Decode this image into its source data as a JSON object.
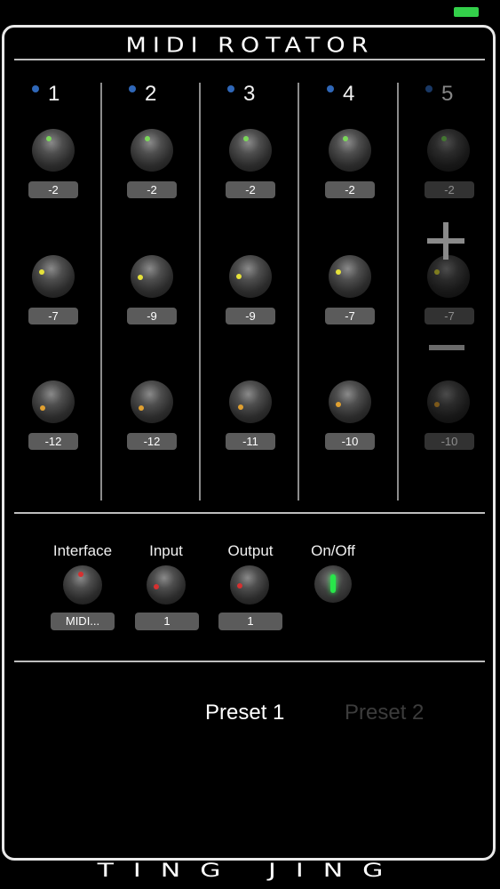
{
  "status_bar": {
    "battery_color": "#33d04a"
  },
  "app": {
    "title": "MIDI ROTATOR",
    "footer": "TING JING"
  },
  "channels": [
    {
      "number": "1",
      "knobs": [
        {
          "value": "-2",
          "dot": "#7bd85a"
        },
        {
          "value": "-7",
          "dot": "#e6e23a"
        },
        {
          "value": "-12",
          "dot": "#e0a030"
        }
      ]
    },
    {
      "number": "2",
      "knobs": [
        {
          "value": "-2",
          "dot": "#7bd85a"
        },
        {
          "value": "-9",
          "dot": "#e6e23a"
        },
        {
          "value": "-12",
          "dot": "#e0a030"
        }
      ]
    },
    {
      "number": "3",
      "knobs": [
        {
          "value": "-2",
          "dot": "#7bd85a"
        },
        {
          "value": "-9",
          "dot": "#e6e23a"
        },
        {
          "value": "-11",
          "dot": "#e0a030"
        }
      ]
    },
    {
      "number": "4",
      "knobs": [
        {
          "value": "-2",
          "dot": "#7bd85a"
        },
        {
          "value": "-7",
          "dot": "#e6e23a"
        },
        {
          "value": "-10",
          "dot": "#e0a030"
        }
      ]
    },
    {
      "number": "5",
      "knobs": [
        {
          "value": "-2",
          "dot": "#7bd85a"
        },
        {
          "value": "-7",
          "dot": "#e6e23a"
        },
        {
          "value": "-10",
          "dot": "#e0a030"
        }
      ]
    }
  ],
  "controls": {
    "interface": {
      "label": "Interface",
      "value": "MIDI..."
    },
    "input": {
      "label": "Input",
      "value": "1"
    },
    "output": {
      "label": "Output",
      "value": "1"
    },
    "onoff": {
      "label": "On/Off",
      "state": "on"
    }
  },
  "presets": [
    {
      "label": "Preset 1",
      "active": true
    },
    {
      "label": "Preset 2",
      "active": false
    }
  ],
  "colors": {
    "channel_dot": "#2f67b8",
    "knob_red": "#d63030",
    "onoff_green": "#28e64a"
  }
}
